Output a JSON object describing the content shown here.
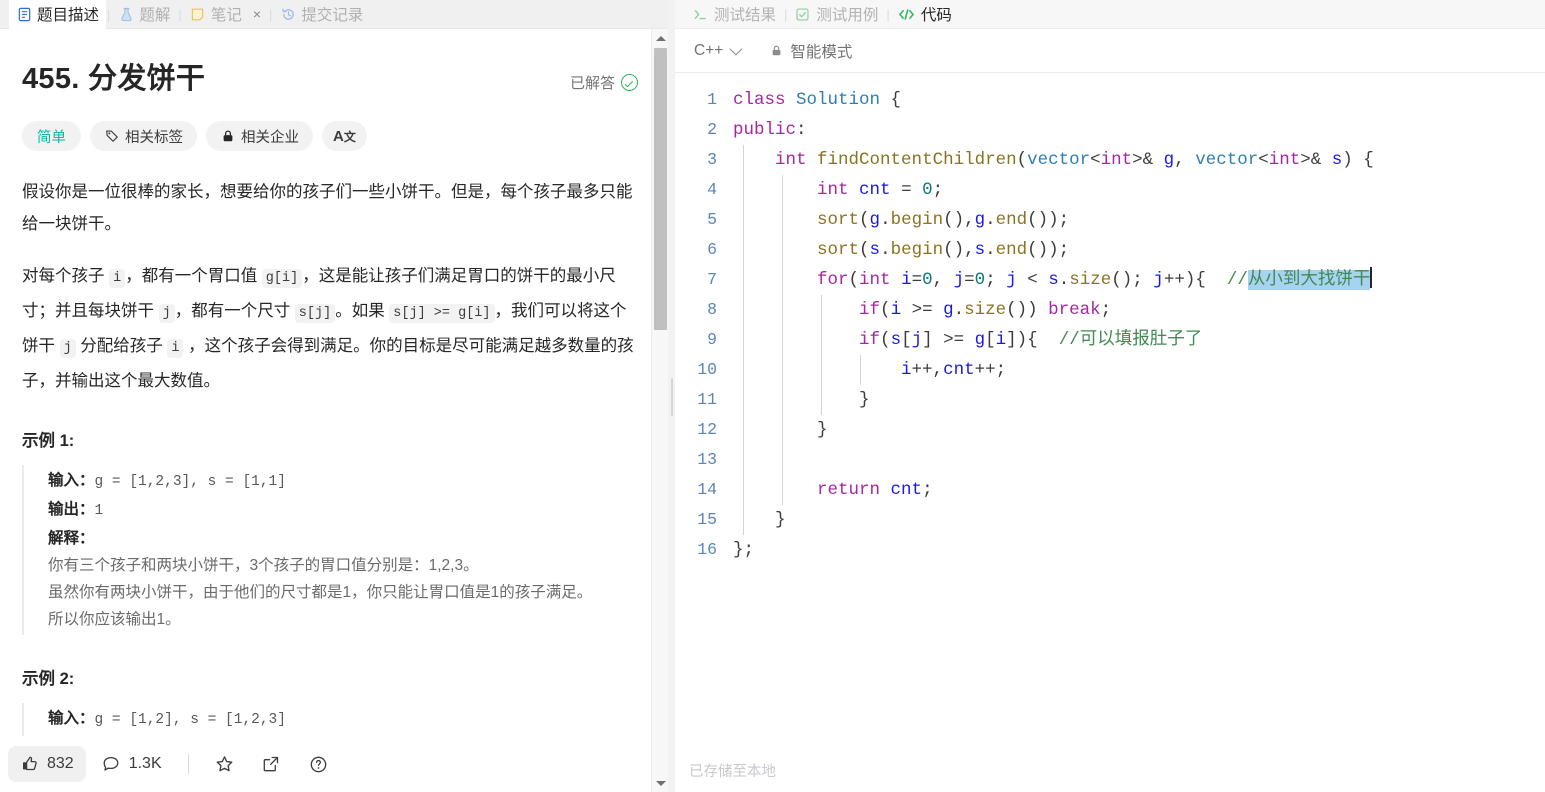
{
  "left_panel": {
    "tabs": [
      {
        "label": "题目描述",
        "icon": "description-icon",
        "active": true,
        "closable": false
      },
      {
        "label": "题解",
        "icon": "flask-icon",
        "active": false,
        "closable": false
      },
      {
        "label": "笔记",
        "icon": "note-icon",
        "active": false,
        "closable": true,
        "close_label": "×"
      },
      {
        "label": "提交记录",
        "icon": "history-icon",
        "active": false,
        "closable": false
      }
    ],
    "problem": {
      "number": "455.",
      "title": "分发饼干",
      "solved_label": "已解答",
      "tags": [
        {
          "label": "简单",
          "icon": null,
          "kind": "difficulty"
        },
        {
          "label": "相关标签",
          "icon": "tag-icon",
          "kind": "normal"
        },
        {
          "label": "相关企业",
          "icon": "lock-icon",
          "kind": "normal"
        },
        {
          "label": "A文",
          "icon": "translate-icon",
          "kind": "icon-only"
        }
      ],
      "paragraph_1": "假设你是一位很棒的家长，想要给你的孩子们一些小饼干。但是，每个孩子最多只能给一块饼干。",
      "paragraph_2_parts": [
        {
          "t": "text",
          "v": "对每个孩子 "
        },
        {
          "t": "code",
          "v": "i"
        },
        {
          "t": "text",
          "v": "，都有一个胃口值 "
        },
        {
          "t": "code",
          "v": "g[i]"
        },
        {
          "t": "text",
          "v": "，这是能让孩子们满足胃口的饼干的最小尺寸；并且每块饼干 "
        },
        {
          "t": "code",
          "v": "j"
        },
        {
          "t": "text",
          "v": "，都有一个尺寸 "
        },
        {
          "t": "code",
          "v": "s[j]"
        },
        {
          "t": "text",
          "v": "。如果 "
        },
        {
          "t": "code",
          "v": "s[j] >= g[i]"
        },
        {
          "t": "text",
          "v": "，我们可以将这个饼干 "
        },
        {
          "t": "code",
          "v": "j"
        },
        {
          "t": "text",
          "v": " 分配给孩子 "
        },
        {
          "t": "code",
          "v": "i"
        },
        {
          "t": "text",
          "v": " ，这个孩子会得到满足。你的目标是尽可能满足越多数量的孩子，并输出这个最大数值。"
        }
      ],
      "example_1": {
        "heading": "示例 1:",
        "input_label": "输入：",
        "input_value": "g = [1,2,3], s = [1,1]",
        "output_label": "输出：",
        "output_value": "1",
        "explain_label": "解释：",
        "explain_lines": [
          "你有三个孩子和两块小饼干，3个孩子的胃口值分别是：1,2,3。",
          "虽然你有两块小饼干，由于他们的尺寸都是1，你只能让胃口值是1的孩子满足。",
          "所以你应该输出1。"
        ]
      },
      "example_2": {
        "heading": "示例 2:",
        "input_label": "输入：",
        "input_value": "g = [1,2], s = [1,2,3]"
      }
    },
    "action_bar": {
      "like": {
        "icon": "thumbs-up-icon",
        "count": "832"
      },
      "comment": {
        "icon": "comment-icon",
        "count": "1.3K"
      },
      "star": {
        "icon": "star-icon"
      },
      "share": {
        "icon": "share-icon"
      },
      "help": {
        "icon": "question-circle-icon"
      }
    }
  },
  "right_panel": {
    "tabs": [
      {
        "label": "测试结果",
        "icon": "terminal-icon",
        "active": false
      },
      {
        "label": "测试用例",
        "icon": "check-square-icon",
        "active": false
      },
      {
        "label": "代码",
        "icon": "code-icon",
        "active": true
      }
    ],
    "toolbar": {
      "language": "C++",
      "language_chevron": "chevron-down-icon",
      "smart_mode_icon": "lock-icon",
      "smart_mode_label": "智能模式"
    },
    "status_text": "已存储至本地",
    "editor": {
      "line_numbers": [
        "1",
        "2",
        "3",
        "4",
        "5",
        "6",
        "7",
        "8",
        "9",
        "10",
        "11",
        "12",
        "13",
        "14",
        "15",
        "16"
      ],
      "lines": [
        {
          "n": "1",
          "guides": [],
          "tokens": [
            {
              "c": "kw",
              "v": "class"
            },
            {
              "c": "pun",
              "v": " "
            },
            {
              "c": "typ",
              "v": "Solution"
            },
            {
              "c": "pun",
              "v": " {"
            }
          ]
        },
        {
          "n": "2",
          "guides": [],
          "tokens": [
            {
              "c": "kw",
              "v": "public"
            },
            {
              "c": "pun",
              "v": ":"
            }
          ]
        },
        {
          "n": "3",
          "guides": [
            "ig1"
          ],
          "tokens": [
            {
              "c": "pun",
              "v": "    "
            },
            {
              "c": "kw",
              "v": "int"
            },
            {
              "c": "pun",
              "v": " "
            },
            {
              "c": "fn",
              "v": "findContentChildren"
            },
            {
              "c": "pun",
              "v": "("
            },
            {
              "c": "typ",
              "v": "vector"
            },
            {
              "c": "pun",
              "v": "<"
            },
            {
              "c": "kw",
              "v": "int"
            },
            {
              "c": "pun",
              "v": ">& "
            },
            {
              "c": "var",
              "v": "g"
            },
            {
              "c": "pun",
              "v": ", "
            },
            {
              "c": "typ",
              "v": "vector"
            },
            {
              "c": "pun",
              "v": "<"
            },
            {
              "c": "kw",
              "v": "int"
            },
            {
              "c": "pun",
              "v": ">& "
            },
            {
              "c": "var",
              "v": "s"
            },
            {
              "c": "pun",
              "v": ") {"
            }
          ]
        },
        {
          "n": "4",
          "guides": [
            "ig1",
            "ig2"
          ],
          "tokens": [
            {
              "c": "pun",
              "v": "        "
            },
            {
              "c": "kw",
              "v": "int"
            },
            {
              "c": "pun",
              "v": " "
            },
            {
              "c": "var",
              "v": "cnt"
            },
            {
              "c": "pun",
              "v": " = "
            },
            {
              "c": "num",
              "v": "0"
            },
            {
              "c": "pun",
              "v": ";"
            }
          ]
        },
        {
          "n": "5",
          "guides": [
            "ig1",
            "ig2"
          ],
          "tokens": [
            {
              "c": "pun",
              "v": "        "
            },
            {
              "c": "fn",
              "v": "sort"
            },
            {
              "c": "pun",
              "v": "("
            },
            {
              "c": "var",
              "v": "g"
            },
            {
              "c": "pun",
              "v": "."
            },
            {
              "c": "fn",
              "v": "begin"
            },
            {
              "c": "pun",
              "v": "(),"
            },
            {
              "c": "var",
              "v": "g"
            },
            {
              "c": "pun",
              "v": "."
            },
            {
              "c": "fn",
              "v": "end"
            },
            {
              "c": "pun",
              "v": "());"
            }
          ]
        },
        {
          "n": "6",
          "guides": [
            "ig1",
            "ig2"
          ],
          "tokens": [
            {
              "c": "pun",
              "v": "        "
            },
            {
              "c": "fn",
              "v": "sort"
            },
            {
              "c": "pun",
              "v": "("
            },
            {
              "c": "var",
              "v": "s"
            },
            {
              "c": "pun",
              "v": "."
            },
            {
              "c": "fn",
              "v": "begin"
            },
            {
              "c": "pun",
              "v": "(),"
            },
            {
              "c": "var",
              "v": "s"
            },
            {
              "c": "pun",
              "v": "."
            },
            {
              "c": "fn",
              "v": "end"
            },
            {
              "c": "pun",
              "v": "());"
            }
          ]
        },
        {
          "n": "7",
          "guides": [
            "ig1",
            "ig2"
          ],
          "tokens": [
            {
              "c": "pun",
              "v": "        "
            },
            {
              "c": "kw",
              "v": "for"
            },
            {
              "c": "pun",
              "v": "("
            },
            {
              "c": "kw",
              "v": "int"
            },
            {
              "c": "pun",
              "v": " "
            },
            {
              "c": "var",
              "v": "i"
            },
            {
              "c": "pun",
              "v": "="
            },
            {
              "c": "num",
              "v": "0"
            },
            {
              "c": "pun",
              "v": ", "
            },
            {
              "c": "var",
              "v": "j"
            },
            {
              "c": "pun",
              "v": "="
            },
            {
              "c": "num",
              "v": "0"
            },
            {
              "c": "pun",
              "v": "; "
            },
            {
              "c": "var",
              "v": "j"
            },
            {
              "c": "pun",
              "v": " < "
            },
            {
              "c": "var",
              "v": "s"
            },
            {
              "c": "pun",
              "v": "."
            },
            {
              "c": "fn",
              "v": "size"
            },
            {
              "c": "pun",
              "v": "(); "
            },
            {
              "c": "var",
              "v": "j"
            },
            {
              "c": "pun",
              "v": "++){  "
            },
            {
              "c": "cmt",
              "v": "//"
            },
            {
              "c": "cmt sel",
              "v": "从小到大找饼干"
            },
            {
              "c": "caret",
              "v": ""
            }
          ]
        },
        {
          "n": "8",
          "guides": [
            "ig1",
            "ig2",
            "ig3"
          ],
          "tokens": [
            {
              "c": "pun",
              "v": "            "
            },
            {
              "c": "kw",
              "v": "if"
            },
            {
              "c": "pun",
              "v": "("
            },
            {
              "c": "var",
              "v": "i"
            },
            {
              "c": "pun",
              "v": " >= "
            },
            {
              "c": "var",
              "v": "g"
            },
            {
              "c": "pun",
              "v": "."
            },
            {
              "c": "fn",
              "v": "size"
            },
            {
              "c": "pun",
              "v": "()) "
            },
            {
              "c": "kw",
              "v": "break"
            },
            {
              "c": "pun",
              "v": ";"
            }
          ]
        },
        {
          "n": "9",
          "guides": [
            "ig1",
            "ig2",
            "ig3"
          ],
          "tokens": [
            {
              "c": "pun",
              "v": "            "
            },
            {
              "c": "kw",
              "v": "if"
            },
            {
              "c": "pun",
              "v": "("
            },
            {
              "c": "var",
              "v": "s"
            },
            {
              "c": "pun",
              "v": "["
            },
            {
              "c": "var",
              "v": "j"
            },
            {
              "c": "pun",
              "v": "] >= "
            },
            {
              "c": "var",
              "v": "g"
            },
            {
              "c": "pun",
              "v": "["
            },
            {
              "c": "var",
              "v": "i"
            },
            {
              "c": "pun",
              "v": "]){  "
            },
            {
              "c": "cmt",
              "v": "//可以填报肚子了"
            }
          ]
        },
        {
          "n": "10",
          "guides": [
            "ig1",
            "ig2",
            "ig3",
            "ig4"
          ],
          "tokens": [
            {
              "c": "pun",
              "v": "                "
            },
            {
              "c": "var",
              "v": "i"
            },
            {
              "c": "pun",
              "v": "++,"
            },
            {
              "c": "var",
              "v": "cnt"
            },
            {
              "c": "pun",
              "v": "++;"
            }
          ]
        },
        {
          "n": "11",
          "guides": [
            "ig1",
            "ig2",
            "ig3"
          ],
          "tokens": [
            {
              "c": "pun",
              "v": "            }"
            }
          ]
        },
        {
          "n": "12",
          "guides": [
            "ig1",
            "ig2"
          ],
          "tokens": [
            {
              "c": "pun",
              "v": "        }"
            }
          ]
        },
        {
          "n": "13",
          "guides": [
            "ig1",
            "ig2"
          ],
          "tokens": [
            {
              "c": "pun",
              "v": ""
            }
          ]
        },
        {
          "n": "14",
          "guides": [
            "ig1",
            "ig2"
          ],
          "tokens": [
            {
              "c": "pun",
              "v": "        "
            },
            {
              "c": "kw",
              "v": "return"
            },
            {
              "c": "pun",
              "v": " "
            },
            {
              "c": "var",
              "v": "cnt"
            },
            {
              "c": "pun",
              "v": ";"
            }
          ]
        },
        {
          "n": "15",
          "guides": [
            "ig1"
          ],
          "tokens": [
            {
              "c": "pun",
              "v": "    }"
            }
          ]
        },
        {
          "n": "16",
          "guides": [],
          "tokens": [
            {
              "c": "pun",
              "v": "};"
            }
          ]
        }
      ]
    }
  },
  "colors": {
    "difficulty_easy": "#0bb8a5",
    "solved_green": "#2db55d",
    "active_tab_text": "#262626",
    "inactive_tab_text": "#b3b3b3",
    "selection_highlight": "#a8d3f0",
    "keyword": "#a626a4",
    "type": "#2b7fb5",
    "function": "#8a7422",
    "variable": "#1a1ae6",
    "number": "#0b7a75",
    "comment": "#3f8a52",
    "line_number": "#5b86b5"
  }
}
